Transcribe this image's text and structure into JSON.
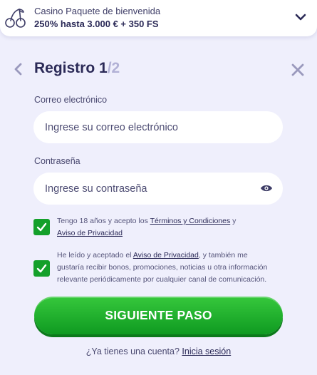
{
  "bonus": {
    "title": "Casino Paquete de bienvenida",
    "offer": "250% hasta 3.000 € + 350 FS",
    "icon": "cherry-icon"
  },
  "header": {
    "title": "Registro",
    "step_current": "1",
    "step_total": "/2"
  },
  "form": {
    "email_label": "Correo electrónico",
    "email_placeholder": "Ingrese su correo electrónico",
    "email_value": "",
    "password_label": "Contraseña",
    "password_placeholder": "Ingrese su contraseña",
    "password_value": ""
  },
  "consents": [
    {
      "checked": true,
      "text_before": "Tengo 18 años y acepto los ",
      "link1": "Términos y Condiciones",
      "text_middle": " y ",
      "link2": "Aviso de Privacidad"
    },
    {
      "checked": true,
      "text_before": "He leído y aceptado el ",
      "link": "Aviso de Privacidad",
      "text_after": ", y también me gustaría recibir bonos, promociones, noticias u otra información relevante periódicamente por cualquier canal de comunicación."
    }
  ],
  "cta": {
    "label": "SIGUIENTE PASO"
  },
  "footer": {
    "question": "¿Ya tienes una cuenta? ",
    "login_link": "Inicia sesión"
  },
  "colors": {
    "background": "#efeffc",
    "text": "#2b2a57",
    "accent_green": "#14a02a",
    "muted": "#b2b1d6"
  }
}
